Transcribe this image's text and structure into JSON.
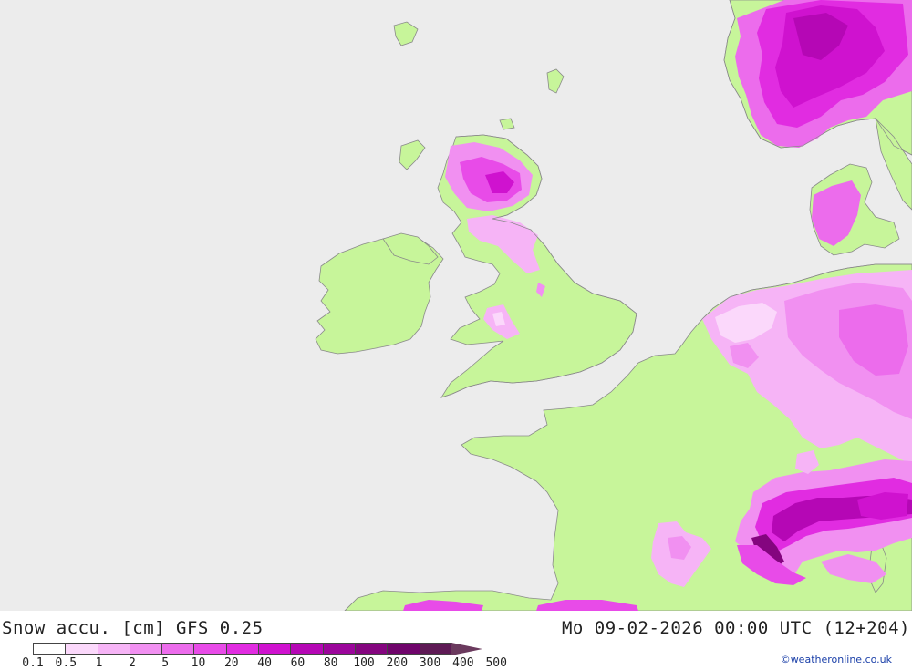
{
  "map": {
    "colors": {
      "sea": "#ececec",
      "land": "#c7f59a",
      "coast": "#8a8a8a"
    }
  },
  "footer": {
    "title": "Snow accu. [cm] GFS 0.25",
    "valid_time": "Mo 09-02-2026 00:00 UTC (12+204)",
    "credit": "©weatheronline.co.uk"
  },
  "legend": {
    "ticks": [
      "0.1",
      "0.5",
      "1",
      "2",
      "5",
      "10",
      "20",
      "40",
      "60",
      "80",
      "100",
      "200",
      "300",
      "400",
      "500"
    ],
    "colors": [
      "#ffffff",
      "#fbd8fb",
      "#f6b4f6",
      "#f190f1",
      "#ec6cec",
      "#e84be8",
      "#e12ce1",
      "#cf12cf",
      "#b507b5",
      "#9b069b",
      "#84057f",
      "#6f046b",
      "#5e1a55",
      "#6b3a5e"
    ]
  }
}
